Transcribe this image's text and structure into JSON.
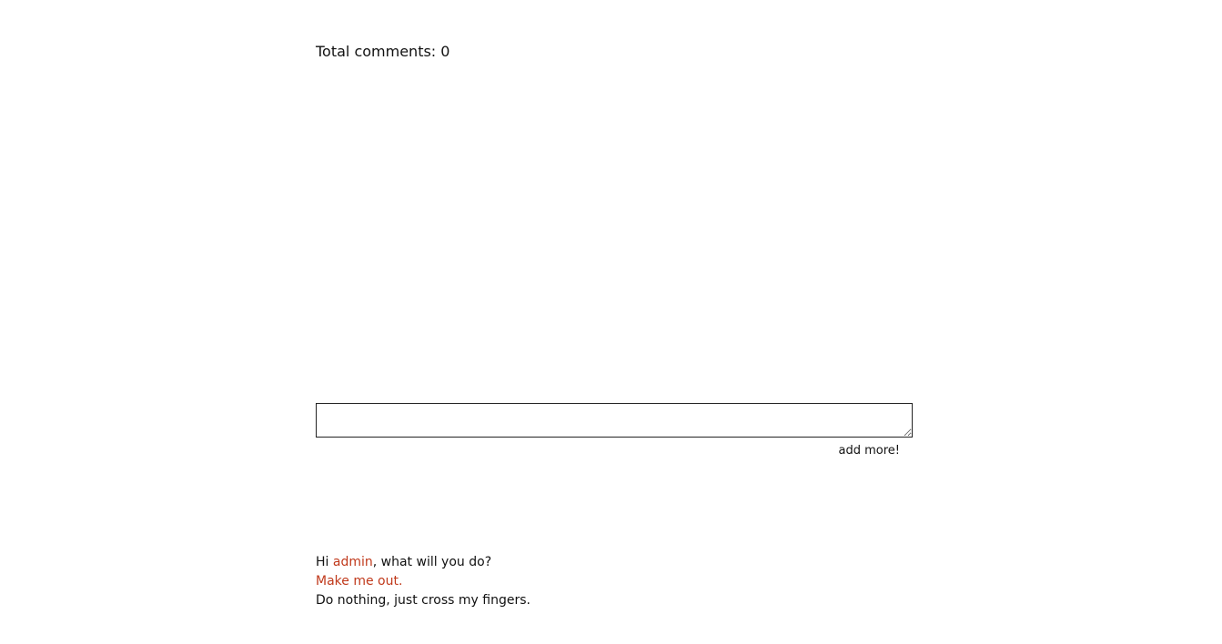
{
  "comments": {
    "total_label": "Total comments: 0"
  },
  "form": {
    "textarea_value": "",
    "submit_label": "add more!"
  },
  "footer": {
    "greeting_prefix": "Hi ",
    "username": "admin",
    "greeting_suffix": ", what will you do?",
    "logout_label": "Make me out.",
    "nothing_label": "Do nothing, just cross my fingers."
  },
  "colors": {
    "link": "#c0391b",
    "text": "#111111",
    "background": "#ffffff"
  }
}
